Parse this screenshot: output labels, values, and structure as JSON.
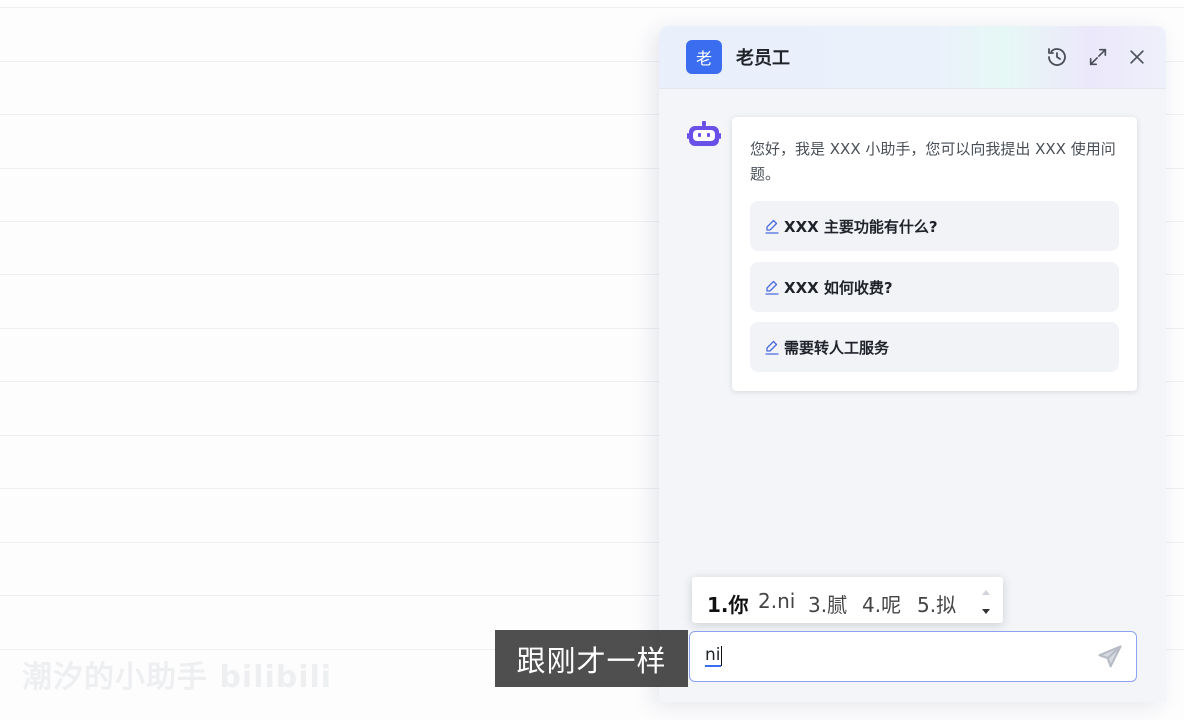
{
  "panel": {
    "avatar_char": "老",
    "title": "老员工",
    "header_icons": [
      "history-icon",
      "expand-icon",
      "close-icon"
    ]
  },
  "chat": {
    "greeting": "您好，我是 XXX 小助手，您可以向我提出 XXX 使用问题。",
    "suggestions": [
      {
        "label": "XXX 主要功能有什么?"
      },
      {
        "label": "XXX 如何收费?"
      },
      {
        "label": "需要转人工服务"
      }
    ]
  },
  "ime": {
    "candidates": [
      "1.你",
      "2.ni",
      "3.腻",
      "4.呢",
      "5.拟"
    ]
  },
  "input": {
    "value": "ni"
  },
  "subtitle": {
    "text": "跟刚才一样"
  },
  "watermark": {
    "text": "潮汐的小助手 bilibili"
  },
  "colors": {
    "accent": "#3a6df0",
    "bot_purple": "#6a4fe8",
    "panel_bg": "#f3f5f8"
  }
}
